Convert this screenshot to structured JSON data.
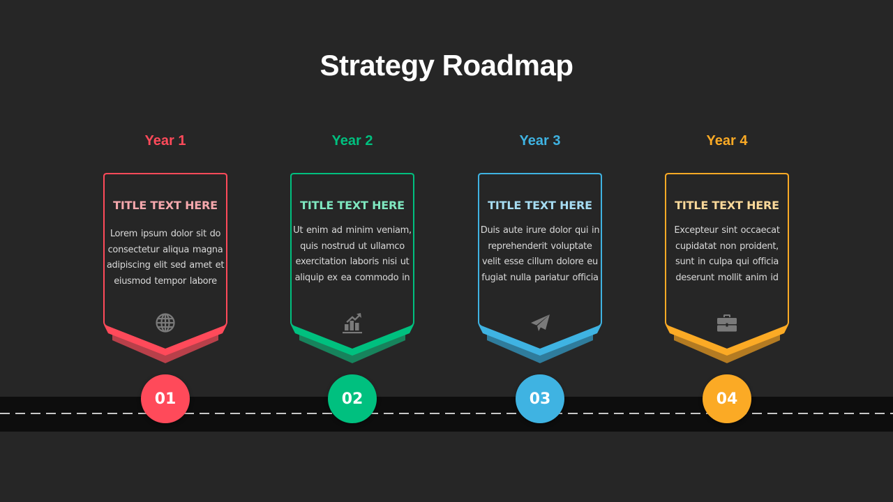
{
  "title": "Strategy Roadmap",
  "icon_color": "#7a7a7a",
  "road": {
    "background": "#0d0d0d",
    "dash_color": "#c8c8c8"
  },
  "stages": [
    {
      "year": "Year 1",
      "title": "TITLE TEXT HERE",
      "body": "Lorem ipsum dolor sit do consectetur aliqua magna adipiscing elit sed amet et eiusmod tempor labore",
      "icon": "globe-icon",
      "step": "01",
      "accent": "#ff4a5a",
      "accent_dark": "#b8404a",
      "title_color": "#f6a8ad"
    },
    {
      "year": "Year 2",
      "title": "TITLE TEXT HERE",
      "body": "Ut enim ad minim veniam, quis nostrud ut ullamco exercitation laboris nisi ut aliquip ex ea commodo in",
      "icon": "chart-growth-icon",
      "step": "02",
      "accent": "#00c07f",
      "accent_dark": "#17835c",
      "title_color": "#7fe8c0"
    },
    {
      "year": "Year 3",
      "title": "TITLE TEXT HERE",
      "body": "Duis aute irure dolor qui in reprehenderit voluptate velit esse cillum dolore eu fugiat nulla pariatur officia",
      "icon": "paper-plane-icon",
      "step": "03",
      "accent": "#3fb3e2",
      "accent_dark": "#2f7c9c",
      "title_color": "#a6dcf2"
    },
    {
      "year": "Year 4",
      "title": "TITLE TEXT HERE",
      "body": "Excepteur sint occaecat cupidatat non proident, sunt in culpa qui officia deserunt mollit anim id",
      "icon": "briefcase-icon",
      "step": "04",
      "accent": "#fbaa25",
      "accent_dark": "#b47b22",
      "title_color": "#fbd99a"
    }
  ]
}
